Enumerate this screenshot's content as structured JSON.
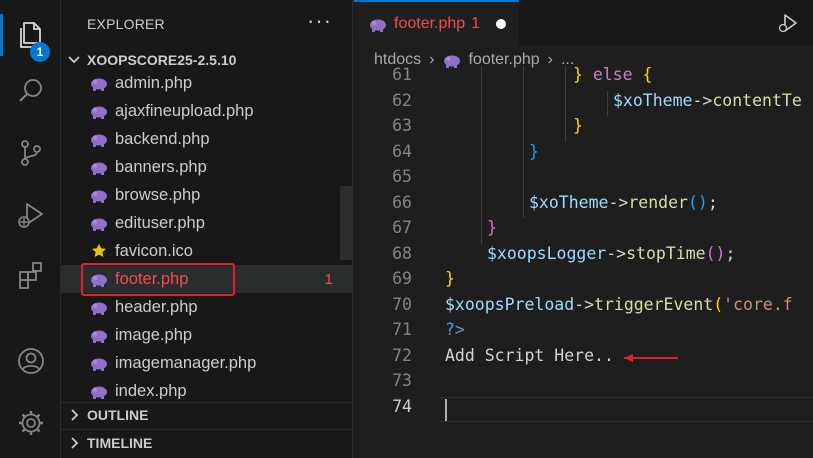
{
  "activity_bar": {
    "explorer_badge": "1",
    "items": [
      "files-icon",
      "search-icon",
      "source-control-icon",
      "run-debug-icon",
      "extensions-icon",
      "account-icon",
      "settings-gear-icon"
    ]
  },
  "sidebar": {
    "title": "EXPLORER",
    "more_label": "···",
    "folder": "XOOPSCORE25-2.5.10",
    "files": [
      {
        "name": "admin.php",
        "icon": "php-elephant-icon"
      },
      {
        "name": "ajaxfineupload.php",
        "icon": "php-elephant-icon"
      },
      {
        "name": "backend.php",
        "icon": "php-elephant-icon"
      },
      {
        "name": "banners.php",
        "icon": "php-elephant-icon"
      },
      {
        "name": "browse.php",
        "icon": "php-elephant-icon"
      },
      {
        "name": "edituser.php",
        "icon": "php-elephant-icon"
      },
      {
        "name": "favicon.ico",
        "icon": "star-icon"
      },
      {
        "name": "footer.php",
        "icon": "php-elephant-icon",
        "count": "1"
      },
      {
        "name": "header.php",
        "icon": "php-elephant-icon"
      },
      {
        "name": "image.php",
        "icon": "php-elephant-icon"
      },
      {
        "name": "imagemanager.php",
        "icon": "php-elephant-icon"
      },
      {
        "name": "index.php",
        "icon": "php-elephant-icon"
      }
    ],
    "outline": "OUTLINE",
    "timeline": "TIMELINE"
  },
  "editor": {
    "tab": {
      "label": "footer.php",
      "count": "1"
    },
    "breadcrumb": {
      "folder": "htdocs",
      "file": "footer.php",
      "more": "..."
    },
    "current_line": "74",
    "lines": [
      {
        "n": "61",
        "tokens": [
          {
            "t": "} ",
            "c": "b1"
          },
          {
            "t": "else",
            "c": "t-kw"
          },
          {
            "t": " {",
            "c": "b1"
          }
        ],
        "indent": 128
      },
      {
        "n": "62",
        "tokens": [
          {
            "t": "$xoTheme",
            "c": "t-var"
          },
          {
            "t": "->",
            "c": "t-op"
          },
          {
            "t": "contentTe",
            "c": "t-fn"
          }
        ],
        "indent": 168
      },
      {
        "n": "63",
        "tokens": [
          {
            "t": "}",
            "c": "b1"
          }
        ],
        "indent": 128
      },
      {
        "n": "64",
        "tokens": [
          {
            "t": "}",
            "c": "b3"
          }
        ],
        "indent": 84
      },
      {
        "n": "65",
        "tokens": [],
        "indent": 0
      },
      {
        "n": "66",
        "tokens": [
          {
            "t": "$xoTheme",
            "c": "t-var"
          },
          {
            "t": "->",
            "c": "t-op"
          },
          {
            "t": "render",
            "c": "t-fn"
          },
          {
            "t": "()",
            "c": "b3"
          },
          {
            "t": ";",
            "c": "t-plain"
          }
        ],
        "indent": 84
      },
      {
        "n": "67",
        "tokens": [
          {
            "t": "}",
            "c": "b2"
          }
        ],
        "indent": 42
      },
      {
        "n": "68",
        "tokens": [
          {
            "t": "$xoopsLogger",
            "c": "t-var"
          },
          {
            "t": "->",
            "c": "t-op"
          },
          {
            "t": "stopTime",
            "c": "t-fn"
          },
          {
            "t": "()",
            "c": "b2"
          },
          {
            "t": ";",
            "c": "t-plain"
          }
        ],
        "indent": 42
      },
      {
        "n": "69",
        "tokens": [
          {
            "t": "}",
            "c": "b1"
          }
        ],
        "indent": 0
      },
      {
        "n": "70",
        "tokens": [
          {
            "t": "$xoopsPreload",
            "c": "t-var"
          },
          {
            "t": "->",
            "c": "t-op"
          },
          {
            "t": "triggerEvent",
            "c": "t-fn"
          },
          {
            "t": "(",
            "c": "b1"
          },
          {
            "t": "'core.f",
            "c": "t-str"
          }
        ],
        "indent": 0
      },
      {
        "n": "71",
        "tokens": [
          {
            "t": "?>",
            "c": "t-tag"
          }
        ],
        "indent": 0
      },
      {
        "n": "72",
        "tokens": [
          {
            "t": "Add Script Here..",
            "c": "t-plain"
          }
        ],
        "indent": 0
      },
      {
        "n": "73",
        "tokens": [],
        "indent": 0
      },
      {
        "n": "74",
        "tokens": [],
        "indent": 0
      }
    ]
  },
  "colors": {
    "accent": "#0078d4",
    "error": "#f14c4c",
    "highlight_box": "#e0202a",
    "annotation_arrow": "#e0202a"
  }
}
